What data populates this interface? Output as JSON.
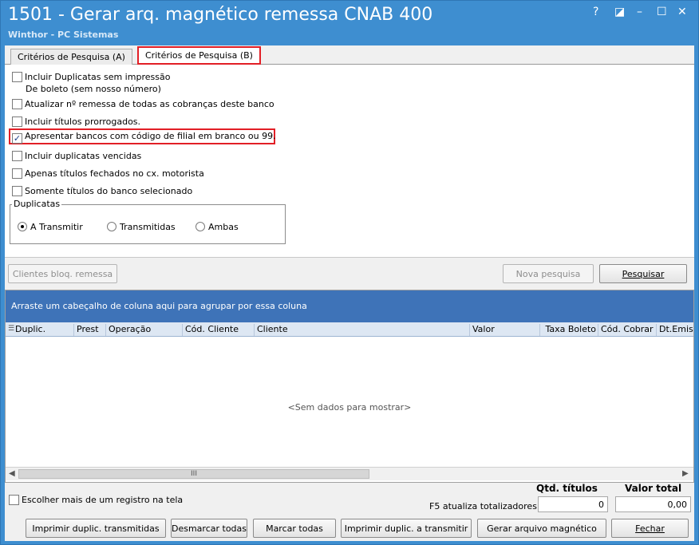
{
  "window": {
    "title": "1501 - Gerar arq. magnético remessa CNAB 400",
    "subtitle": "Winthor - PC Sistemas",
    "controls": [
      "?",
      "◪",
      "–",
      "☐",
      "✕"
    ]
  },
  "tabs": [
    {
      "label": "Critérios de Pesquisa (A)",
      "active": false
    },
    {
      "label": "Critérios de Pesquisa (B)",
      "active": true
    }
  ],
  "criteria": {
    "checkboxes": [
      {
        "label": "Incluir Duplicatas sem impressão",
        "label2": "De boleto (sem nosso número)",
        "checked": false
      },
      {
        "label": "Atualizar nº remessa de todas as cobranças deste banco",
        "checked": false
      },
      {
        "label": "Incluir títulos prorrogados.",
        "checked": false
      },
      {
        "label": "Apresentar bancos com código de filial em branco ou 99.",
        "checked": true
      },
      {
        "label": "Incluir duplicatas vencidas",
        "checked": false
      },
      {
        "label": "Apenas títulos fechados no cx. motorista",
        "checked": false
      },
      {
        "label": "Somente títulos do banco selecionado",
        "checked": false
      }
    ],
    "duplicatas": {
      "legend": "Duplicatas",
      "options": [
        "A Transmitir",
        "Transmitidas",
        "Ambas"
      ],
      "selected": "A Transmitir"
    }
  },
  "buttons": {
    "clientes_bloq": "Clientes bloq. remessa",
    "nova_pesquisa": "Nova pesquisa",
    "pesquisar": "Pesquisar"
  },
  "grid": {
    "group_hint": "Arraste um cabeçalho de coluna aqui para agrupar por essa coluna",
    "columns": [
      "Duplic.",
      "Prest",
      "Operação",
      "Cód. Cliente",
      "Cliente",
      "Valor",
      "Taxa Boleto",
      "Cód. Cobrar",
      "Dt.Emis"
    ],
    "empty_text": "<Sem dados para mostrar>",
    "scroll_thumb": "III"
  },
  "footer": {
    "multi_select_label": "Escolher mais de um registro na tela",
    "totals_hint": "F5 atualiza totalizadores",
    "qtd_titulos_label": "Qtd. títulos",
    "qtd_titulos_value": "0",
    "valor_total_label": "Valor total",
    "valor_total_value": "0,00",
    "actions": {
      "imprimir_transmitidas": "Imprimir duplic. transmitidas",
      "desmarcar": "Desmarcar todas",
      "marcar": "Marcar todas",
      "imprimir_a_transmitir": "Imprimir duplic. a transmitir",
      "gerar": "Gerar arquivo magnético",
      "fechar": "Fechar"
    }
  }
}
